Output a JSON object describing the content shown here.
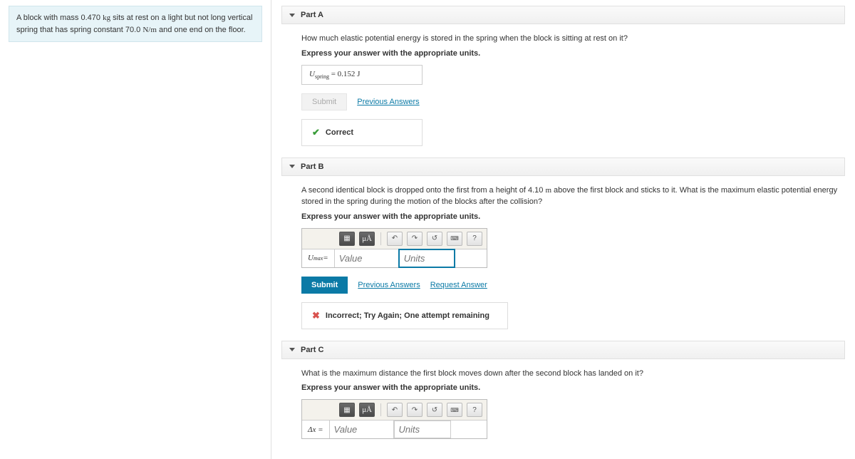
{
  "problem": {
    "text_before_mass": "A block with mass 0.470 ",
    "mass_unit": "kg",
    "text_mid": " sits at rest on a light but not long vertical spring that has spring constant 70.0 ",
    "k_unit": "N/m",
    "text_after": " and one end on the floor."
  },
  "partA": {
    "title": "Part A",
    "question": "How much elastic potential energy is stored in the spring when the block is sitting at rest on it?",
    "instruction": "Express your answer with the appropriate units.",
    "answer_var": "U",
    "answer_sub": "spring",
    "answer_eq": " = 0.152 J",
    "submit": "Submit",
    "prev": "Previous Answers",
    "feedback": "Correct"
  },
  "partB": {
    "title": "Part B",
    "question_before": "A second identical block is dropped onto the first from a height of 4.10 ",
    "height_unit": "m",
    "question_after": " above the first block and sticks to it. What is the maximum elastic potential energy stored in the spring during the motion of the blocks after the collision?",
    "instruction": "Express your answer with the appropriate units.",
    "var": "U",
    "var_sub": "max",
    "var_eq": " = ",
    "value_ph": "Value",
    "units_ph": "Units",
    "submit": "Submit",
    "prev": "Previous Answers",
    "req": "Request Answer",
    "feedback": "Incorrect; Try Again; One attempt remaining",
    "uA": "μÅ",
    "help": "?"
  },
  "partC": {
    "title": "Part C",
    "question": "What is the maximum distance the first block moves down after the second block has landed on it?",
    "instruction": "Express your answer with the appropriate units.",
    "var": "Δx = ",
    "value_ph": "Value",
    "units_ph": "Units",
    "uA": "μÅ",
    "help": "?"
  }
}
